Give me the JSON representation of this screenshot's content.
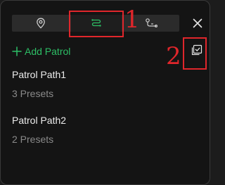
{
  "tabs": [
    {
      "icon": "location-pin-icon"
    },
    {
      "icon": "patrol-route-icon",
      "active": true,
      "accent": "#2dbf66"
    },
    {
      "icon": "path-user-icon"
    }
  ],
  "add_patrol": {
    "label": "Add Patrol",
    "icon": "plus-icon"
  },
  "patrols": [
    {
      "name": "Patrol Path1",
      "presets": "3 Presets"
    },
    {
      "name": "Patrol Path2",
      "presets": "2 Presets"
    }
  ],
  "annotations": [
    {
      "number": "1"
    },
    {
      "number": "2"
    }
  ],
  "colors": {
    "accent": "#2dbf66",
    "annotation": "#e0262b",
    "background": "#141414"
  }
}
